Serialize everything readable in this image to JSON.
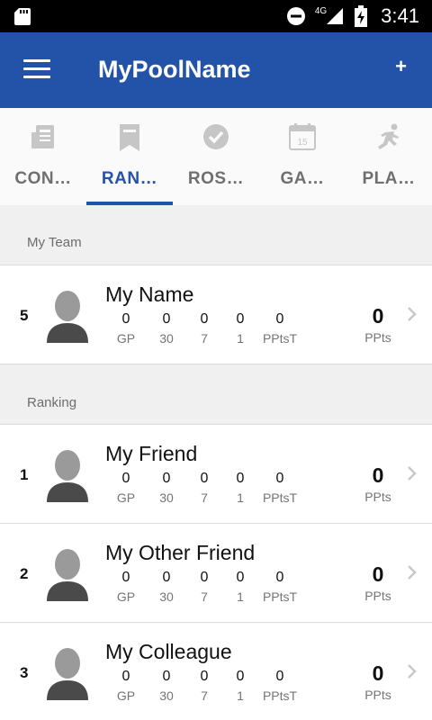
{
  "status_bar": {
    "time": "3:41",
    "network": "4G",
    "icons": [
      "sd-card-icon",
      "do-not-disturb-icon",
      "signal-icon",
      "battery-charging-icon"
    ]
  },
  "app_bar": {
    "title": "MyPoolName",
    "add_label": "+",
    "background": "#2353a8"
  },
  "tabs": [
    {
      "label": "CON…",
      "icon": "newspaper-icon",
      "active": false
    },
    {
      "label": "RAN…",
      "icon": "bookmark-icon",
      "active": true
    },
    {
      "label": "ROS…",
      "icon": "check-circle-icon",
      "active": false
    },
    {
      "label": "GA…",
      "icon": "calendar-icon",
      "calendar_day": "15",
      "active": false
    },
    {
      "label": "PLA…",
      "icon": "runner-icon",
      "active": false
    }
  ],
  "my_team": {
    "header": "My Team",
    "player": {
      "rank": "5",
      "name": "My Name",
      "stats": [
        {
          "value": "0",
          "label": "GP"
        },
        {
          "value": "0",
          "label": "30"
        },
        {
          "value": "0",
          "label": "7"
        },
        {
          "value": "0",
          "label": "1"
        },
        {
          "value": "0",
          "label": "PPtsT"
        }
      ],
      "ppts_value": "0",
      "ppts_label": "PPts"
    }
  },
  "ranking": {
    "header": "Ranking",
    "players": [
      {
        "rank": "1",
        "name": "My Friend",
        "stats": [
          {
            "value": "0",
            "label": "GP"
          },
          {
            "value": "0",
            "label": "30"
          },
          {
            "value": "0",
            "label": "7"
          },
          {
            "value": "0",
            "label": "1"
          },
          {
            "value": "0",
            "label": "PPtsT"
          }
        ],
        "ppts_value": "0",
        "ppts_label": "PPts"
      },
      {
        "rank": "2",
        "name": "My Other Friend",
        "stats": [
          {
            "value": "0",
            "label": "GP"
          },
          {
            "value": "0",
            "label": "30"
          },
          {
            "value": "0",
            "label": "7"
          },
          {
            "value": "0",
            "label": "1"
          },
          {
            "value": "0",
            "label": "PPtsT"
          }
        ],
        "ppts_value": "0",
        "ppts_label": "PPts"
      },
      {
        "rank": "3",
        "name": "My Colleague",
        "stats": [
          {
            "value": "0",
            "label": "GP"
          },
          {
            "value": "0",
            "label": "30"
          },
          {
            "value": "0",
            "label": "7"
          },
          {
            "value": "0",
            "label": "1"
          },
          {
            "value": "0",
            "label": "PPtsT"
          }
        ],
        "ppts_value": "0",
        "ppts_label": "PPts"
      }
    ]
  }
}
